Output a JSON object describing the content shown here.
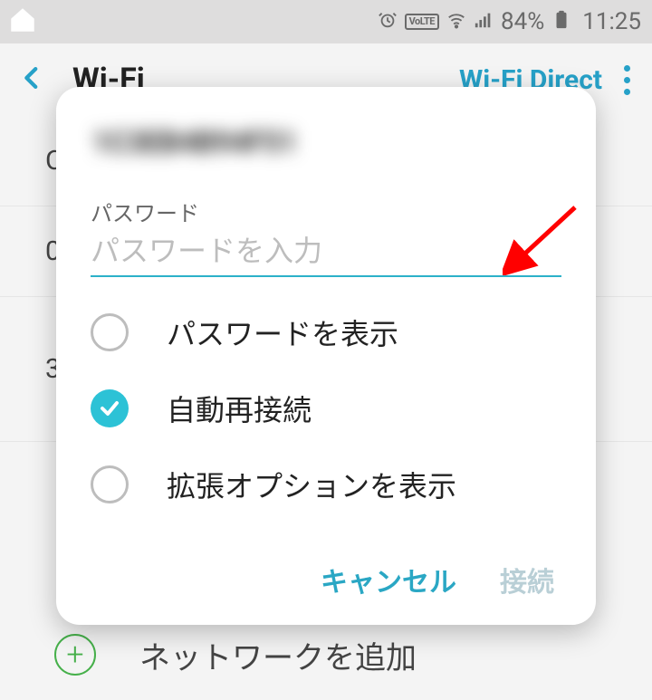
{
  "status": {
    "battery_pct": "84%",
    "time": "11:25",
    "volte": "VoLTE"
  },
  "appbar": {
    "title": "Wi-Fi",
    "action": "Wi-Fi Direct"
  },
  "bg": {
    "connected": "C",
    "row1": "0",
    "row2": "3",
    "add_label": "ネットワークを追加"
  },
  "dialog": {
    "network_name": "1C3EB4B94F51",
    "password_label": "パスワード",
    "password_placeholder": "パスワードを入力",
    "options": {
      "show_password": "パスワードを表示",
      "auto_reconnect": "自動再接続",
      "advanced": "拡張オプションを表示"
    },
    "buttons": {
      "cancel": "キャンセル",
      "connect": "接続"
    }
  }
}
